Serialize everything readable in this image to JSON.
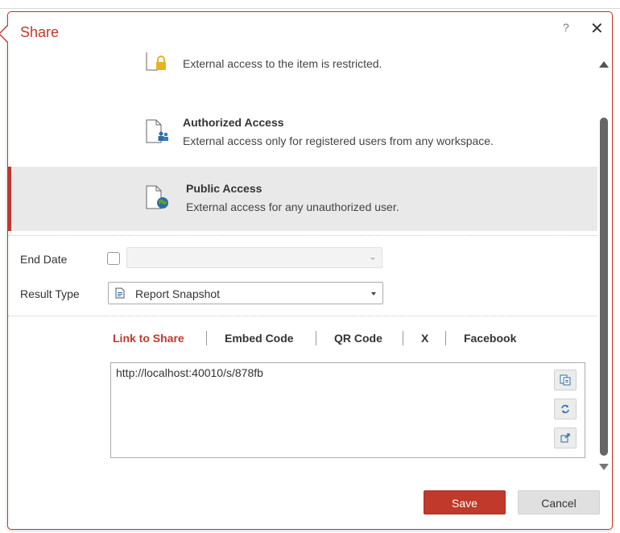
{
  "dialog": {
    "title": "Share",
    "help_label": "?",
    "close_label": "✕"
  },
  "access_options": [
    {
      "title": "",
      "description": "External access to the item is restricted.",
      "icon": "document-lock-icon",
      "selected": false
    },
    {
      "title": "Authorized Access",
      "description": "External access only for registered users from any workspace.",
      "icon": "document-users-icon",
      "selected": false
    },
    {
      "title": "Public Access",
      "description": "External access for any unauthorized user.",
      "icon": "document-globe-icon",
      "selected": true
    }
  ],
  "form": {
    "end_date_label": "End Date",
    "end_date_checked": false,
    "end_date_value": "",
    "result_type_label": "Result Type",
    "result_type_value": "Report Snapshot",
    "result_type_icon": "report-icon"
  },
  "share_tabs": [
    {
      "label": "Link to Share",
      "active": true
    },
    {
      "label": "Embed Code",
      "active": false
    },
    {
      "label": "QR Code",
      "active": false
    },
    {
      "label": "X",
      "active": false
    },
    {
      "label": "Facebook",
      "active": false
    }
  ],
  "link": {
    "url": "http://localhost:40010/s/878fb",
    "actions": [
      "copy-icon",
      "refresh-icon",
      "open-external-icon"
    ]
  },
  "buttons": {
    "save_label": "Save",
    "cancel_label": "Cancel"
  },
  "colors": {
    "accent": "#c0392b",
    "selected_bg": "#e9e9e9"
  }
}
